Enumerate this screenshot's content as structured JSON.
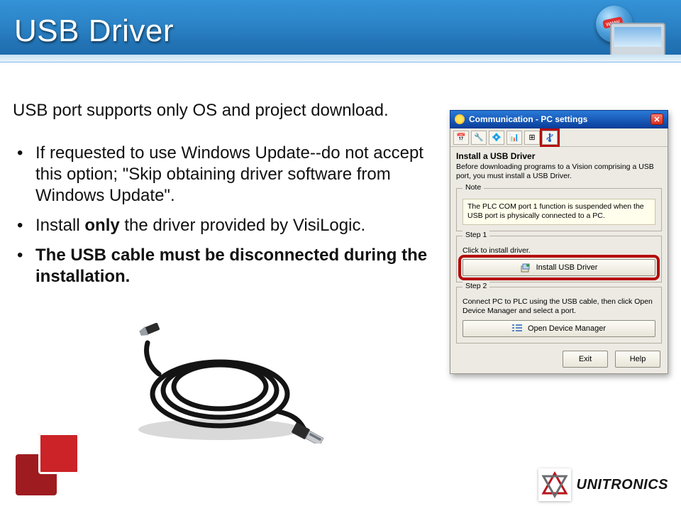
{
  "header": {
    "title": "USB Driver"
  },
  "content": {
    "intro": "USB port supports only OS and project download.",
    "bullets": [
      {
        "pre": "If requested to use Windows Update--do not accept this option; \"Skip obtaining driver software from Windows Update\"."
      },
      {
        "pre": "Install ",
        "bold": "only",
        "post": " the driver provided by VisiLogic."
      },
      {
        "boldAll": "The USB cable must be disconnected during the installation."
      }
    ]
  },
  "dialog": {
    "title": "Communication - PC settings",
    "install_heading": "Install a USB Driver",
    "install_desc": "Before downloading programs to a Vision comprising a USB port, you must install a USB Driver.",
    "note_legend": "Note",
    "note_text": "The PLC COM port 1 function is suspended when the USB port is physically connected to a PC.",
    "step1_legend": "Step 1",
    "step1_text": "Click to install driver.",
    "install_btn": "Install USB Driver",
    "step2_legend": "Step 2",
    "step2_text": "Connect PC to PLC using the USB cable, then click Open Device Manager and select a port.",
    "open_devmgr_btn": "Open Device Manager",
    "exit_btn": "Exit",
    "help_btn": "Help"
  },
  "brand": {
    "name": "UNITRONICS"
  }
}
